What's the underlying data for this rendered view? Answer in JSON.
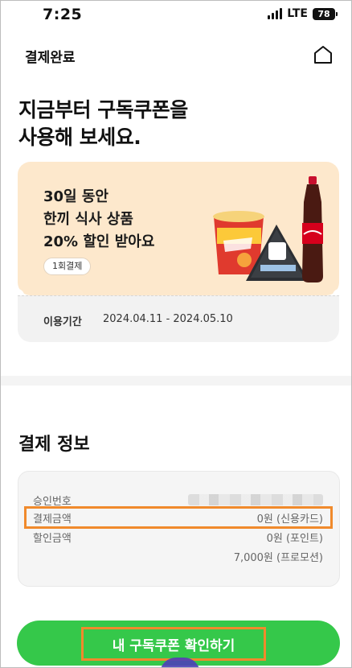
{
  "status_bar": {
    "time": "7:25",
    "network": "LTE",
    "battery": "78"
  },
  "header": {
    "title": "결제완료",
    "home_icon": "home-icon"
  },
  "headline": {
    "line1": "지금부터 구독쿠폰을",
    "line2": "사용해 보세요."
  },
  "coupon": {
    "line1": "30일 동안",
    "line2": "한끼 식사 상품",
    "line3": "20% 할인 받아요",
    "badge": "1회결제",
    "period_label": "이용기간",
    "period_value": "2024.04.11 - 2024.05.10",
    "background_color": "#fde8cc"
  },
  "payment_info": {
    "title": "결제 정보",
    "rows": [
      {
        "label": "승인번호",
        "value": ""
      },
      {
        "label": "결제금액",
        "value": "0원 (신용카드)"
      },
      {
        "label": "할인금액",
        "value": "0원 (포인트)"
      },
      {
        "label": "",
        "value": "7,000원 (프로모션)"
      }
    ]
  },
  "cta": {
    "label": "내 구독쿠폰 확인하기",
    "color": "#35c84a"
  },
  "accent_highlight_color": "#f08a2c"
}
